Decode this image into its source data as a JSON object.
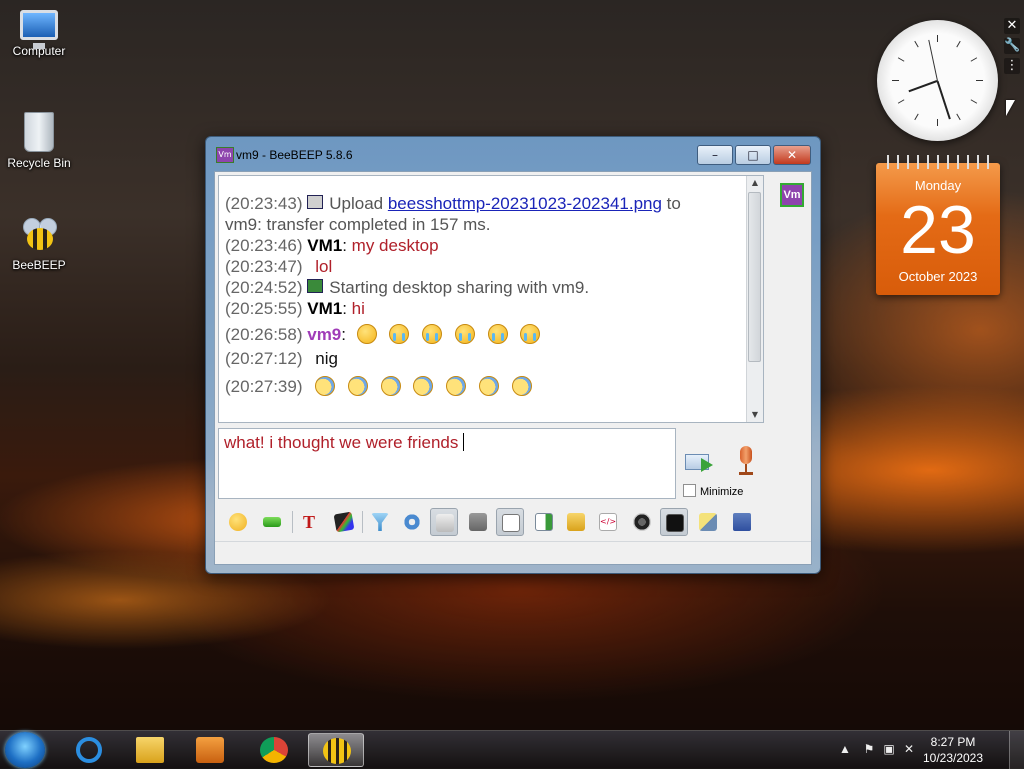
{
  "desktop": {
    "icons": [
      {
        "label": "Computer"
      },
      {
        "label": "Recycle Bin"
      },
      {
        "label": "BeeBEEP"
      }
    ]
  },
  "window": {
    "title": "vm9 - BeeBEEP 5.8.6",
    "app_icon_text": "Vm",
    "controls": {
      "minimize": "–",
      "maximize": "□",
      "close": "✕"
    },
    "chat": {
      "lines": [
        {
          "time": "(20:23:43)",
          "icon": "upload-icon",
          "text": "Upload ",
          "link": "beesshottmp-20231023-202341.png",
          "after": " to"
        },
        {
          "text": "vm9: transfer completed in 157 ms."
        },
        {
          "time": "(20:23:46)",
          "nick": "VM1",
          "sep": ": ",
          "msg": "my desktop"
        },
        {
          "time": "(20:23:47)",
          "msg": "lol"
        },
        {
          "time": "(20:24:52)",
          "icon": "desktop-share-icon",
          "text": "Starting desktop sharing with vm9."
        },
        {
          "time": "(20:25:55)",
          "nick": "VM1",
          "sep": ": ",
          "msg": "hi"
        },
        {
          "time": "(20:26:58)",
          "nick": "vm9",
          "sep": ":",
          "emoji": [
            "worried-face",
            "crying-face",
            "crying-face",
            "crying-face",
            "crying-face",
            "crying-face"
          ]
        },
        {
          "time": "(20:27:12)",
          "msg": "nig"
        },
        {
          "time": "(20:27:39)",
          "emoji": [
            "anxious-face",
            "anxious-face",
            "anxious-face",
            "anxious-face",
            "anxious-face",
            "anxious-face",
            "anxious-face"
          ]
        }
      ]
    },
    "user_list": [
      {
        "label": "Vm",
        "accent": "#8e44ad",
        "border": "#33aa33"
      }
    ],
    "input": {
      "value": "what! i thought we were friends"
    },
    "minimize_label": "Minimize",
    "toolbar": [
      "emoji-button",
      "send-file-button",
      "font-button",
      "color-button",
      "filter-button",
      "settings-button",
      "spellcheck-button",
      "word-complete-button",
      "sound-button",
      "save-chat-button",
      "share-desktop-button",
      "html-button",
      "screenshot-button",
      "terminal-button",
      "notes-button",
      "save-button"
    ]
  },
  "gadgets": {
    "calendar": {
      "weekday": "Monday",
      "day": "23",
      "month_year": "October 2023"
    }
  },
  "taskbar": {
    "apps": [
      "internet-explorer",
      "file-explorer",
      "media-player",
      "chrome",
      "beebeep"
    ],
    "active_app": "beebeep",
    "time": "8:27 PM",
    "date": "10/23/2023"
  }
}
